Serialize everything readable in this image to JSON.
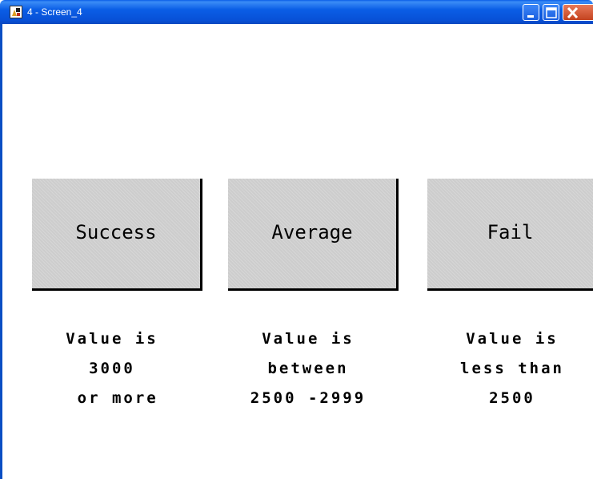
{
  "window": {
    "title": "4 - Screen_4"
  },
  "buttons": [
    {
      "label": "Success",
      "desc": [
        "Value is",
        "3000",
        " or more"
      ]
    },
    {
      "label": "Average",
      "desc": [
        "Value is",
        "between",
        "2500 -2999"
      ]
    },
    {
      "label": "Fail",
      "desc": [
        "Value is",
        "less than",
        "2500"
      ]
    }
  ],
  "colors": {
    "titlebar": "#0a5ee6",
    "button_face": "#cdcdcd",
    "close_button": "#d5532f"
  },
  "icons": {
    "app": "app-icon",
    "minimize": "minimize-icon",
    "maximize": "maximize-icon",
    "close": "close-icon"
  }
}
